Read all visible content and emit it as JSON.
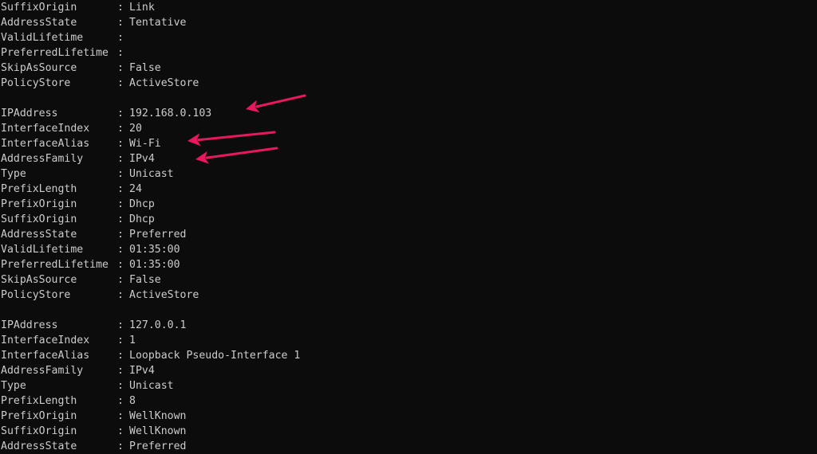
{
  "terminal": {
    "separator": ":",
    "blocks": [
      {
        "rows": [
          {
            "key": "SuffixOrigin",
            "value": "Link"
          },
          {
            "key": "AddressState",
            "value": "Tentative"
          },
          {
            "key": "ValidLifetime",
            "value": ""
          },
          {
            "key": "PreferredLifetime",
            "value": ""
          },
          {
            "key": "SkipAsSource",
            "value": "False"
          },
          {
            "key": "PolicyStore",
            "value": "ActiveStore"
          }
        ]
      },
      {
        "rows": [
          {
            "key": "IPAddress",
            "value": "192.168.0.103"
          },
          {
            "key": "InterfaceIndex",
            "value": "20"
          },
          {
            "key": "InterfaceAlias",
            "value": "Wi-Fi"
          },
          {
            "key": "AddressFamily",
            "value": "IPv4"
          },
          {
            "key": "Type",
            "value": "Unicast"
          },
          {
            "key": "PrefixLength",
            "value": "24"
          },
          {
            "key": "PrefixOrigin",
            "value": "Dhcp"
          },
          {
            "key": "SuffixOrigin",
            "value": "Dhcp"
          },
          {
            "key": "AddressState",
            "value": "Preferred"
          },
          {
            "key": "ValidLifetime",
            "value": "01:35:00"
          },
          {
            "key": "PreferredLifetime",
            "value": "01:35:00"
          },
          {
            "key": "SkipAsSource",
            "value": "False"
          },
          {
            "key": "PolicyStore",
            "value": "ActiveStore"
          }
        ]
      },
      {
        "rows": [
          {
            "key": "IPAddress",
            "value": "127.0.0.1"
          },
          {
            "key": "InterfaceIndex",
            "value": "1"
          },
          {
            "key": "InterfaceAlias",
            "value": "Loopback Pseudo-Interface 1"
          },
          {
            "key": "AddressFamily",
            "value": "IPv4"
          },
          {
            "key": "Type",
            "value": "Unicast"
          },
          {
            "key": "PrefixLength",
            "value": "8"
          },
          {
            "key": "PrefixOrigin",
            "value": "WellKnown"
          },
          {
            "key": "SuffixOrigin",
            "value": "WellKnown"
          },
          {
            "key": "AddressState",
            "value": "Preferred"
          }
        ]
      }
    ]
  },
  "annotations": {
    "arrow_color": "#e8185f",
    "arrows": [
      {
        "name": "arrow-ip-address",
        "points_to": "IPAddress: 192.168.0.103"
      },
      {
        "name": "arrow-interface-alias",
        "points_to": "InterfaceAlias: Wi-Fi"
      },
      {
        "name": "arrow-address-family",
        "points_to": "AddressFamily: IPv4"
      }
    ]
  }
}
